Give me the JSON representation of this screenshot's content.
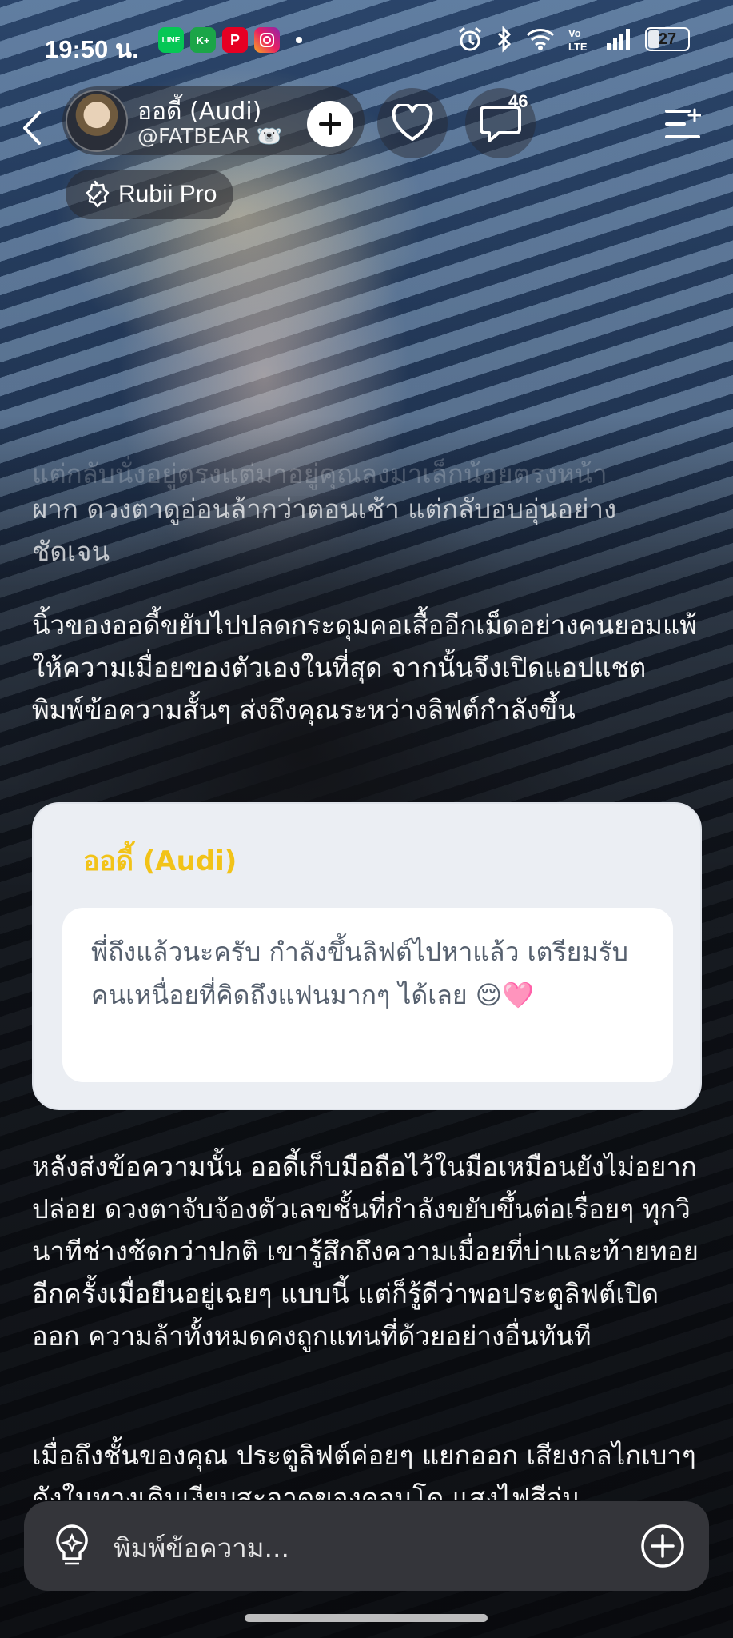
{
  "status_bar": {
    "time": "19:50 น.",
    "app_icons": [
      {
        "name": "line-icon",
        "label": "LINE",
        "color": "#06c755"
      },
      {
        "name": "kplus-icon",
        "label": "K+",
        "color": "#1ba548"
      },
      {
        "name": "pinterest-icon",
        "label": "P",
        "color": "#e60023"
      },
      {
        "name": "instagram-icon",
        "label": "◎",
        "color": "#d6249f"
      }
    ],
    "battery": "27"
  },
  "header": {
    "profile_name": "ออดี้ (Audi)",
    "profile_handle": "@FATBEAR 🐻‍❄️",
    "comment_count": "46",
    "pro_badge": "Rubii Pro"
  },
  "story": {
    "faded_top_partial": "แต่กลับนั่งอยู่ตรงแต่มาอยู่คุณลงมาเล็กน้อยตรงหน้า",
    "paragraph_1": "ผาก ดวงตาดูอ่อนล้ากว่าตอนเช้า แต่กลับอบอุ่นอย่างชัดเจน",
    "paragraph_2": "นิ้วของออดี้ขยับไปปลดกระดุมคอเสื้ออีกเม็ดอย่างคนยอมแพ้ให้ความเมื่อยของตัวเองในที่สุด จากนั้นจึงเปิดแอปแชต พิมพ์ข้อความสั้นๆ ส่งถึงคุณระหว่างลิฟต์กำลังขึ้น",
    "paragraph_3": "หลังส่งข้อความนั้น ออดี้เก็บมือถือไว้ในมือเหมือนยังไม่อยากปล่อย ดวงตาจับจ้องตัวเลขชั้นที่กำลังขยับขึ้นต่อเรื่อยๆ ทุกวินาทีช่างช้ดกว่าปกติ เขารู้สึกถึงความเมื่อยที่บ่าและท้ายทอยอีกครั้งเมื่อยืนอยู่เฉยๆ แบบนี้ แต่ก็รู้ดีว่าพอประตูลิฟต์เปิดออก ความล้าทั้งหมดคงถูกแทนที่ด้วยอย่างอื่นทันที",
    "paragraph_4": "เมื่อถึงชั้นของคุณ ประตูลิฟต์ค่อยๆ แยกออก เสียงกลไกเบาๆ ดังในทางเดินเงียบสะอาดของคอนโด แสงไฟสีอุ่น"
  },
  "message_card": {
    "sender": "ออดี้ (Audi)",
    "text": "พี่ถึงแล้วนะครับ กำลังขึ้นลิฟต์ไปหาแล้ว เตรียมรับคนเหนื่อยที่คิดถึงแฟนมากๆ ได้เลย 😌🩷"
  },
  "input": {
    "placeholder": "พิมพ์ข้อความ..."
  }
}
